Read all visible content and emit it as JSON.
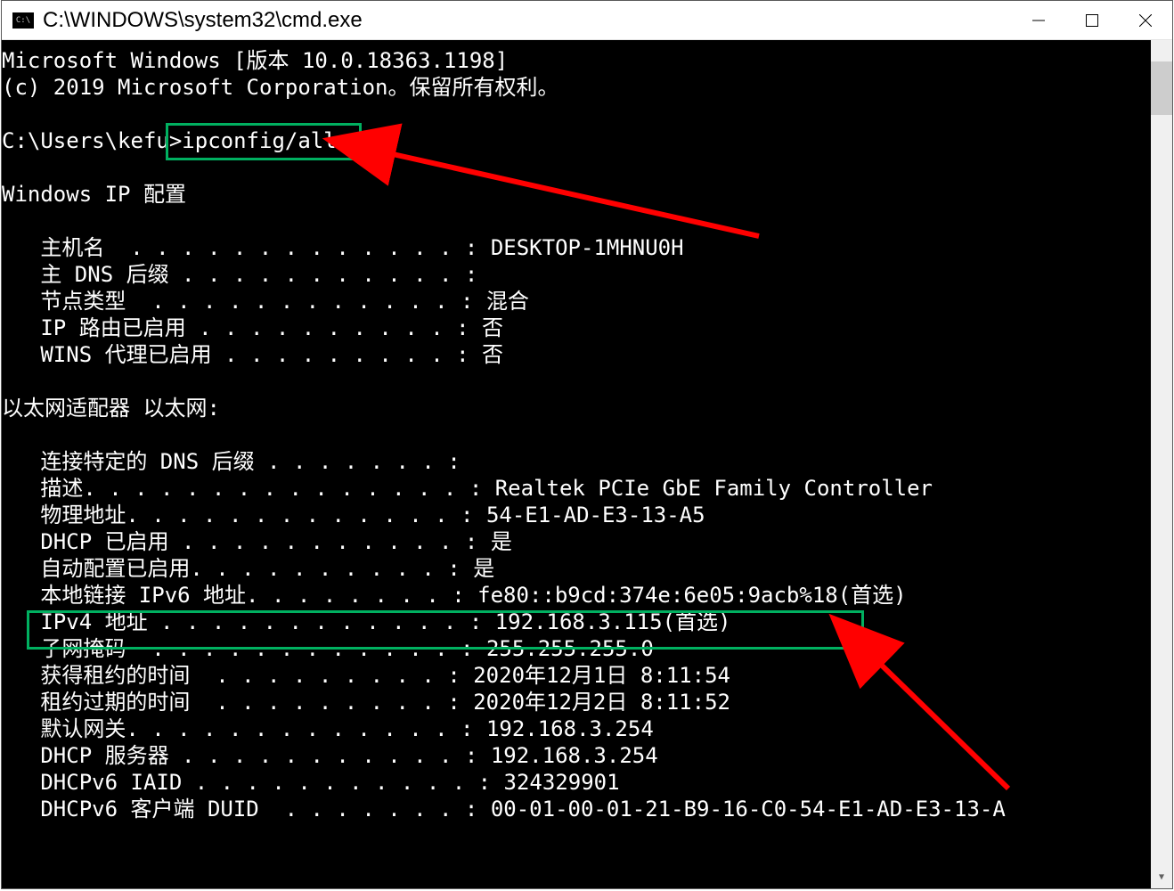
{
  "window": {
    "title": "C:\\WINDOWS\\system32\\cmd.exe"
  },
  "header": {
    "version_line": "Microsoft Windows [版本 10.0.18363.1198]",
    "copyright_line": "(c) 2019 Microsoft Corporation。保留所有权利。"
  },
  "prompt": {
    "path": "C:\\Users\\kefu>",
    "command": "ipconfig/all"
  },
  "sections": {
    "ip_config_header": "Windows IP 配置",
    "host": {
      "hostname_label": "   主机名  . . . . . . . . . . . . . : ",
      "hostname_value": "DESKTOP-1MHNU0H",
      "dns_suffix_label": "   主 DNS 后缀 . . . . . . . . . . . : ",
      "dns_suffix_value": "",
      "node_type_label": "   节点类型  . . . . . . . . . . . . : ",
      "node_type_value": "混合",
      "ip_routing_label": "   IP 路由已启用 . . . . . . . . . . : ",
      "ip_routing_value": "否",
      "wins_proxy_label": "   WINS 代理已启用 . . . . . . . . . : ",
      "wins_proxy_value": "否"
    },
    "adapter_header": "以太网适配器 以太网:",
    "adapter": {
      "conn_dns_label": "   连接特定的 DNS 后缀 . . . . . . . : ",
      "conn_dns_value": "",
      "desc_label": "   描述. . . . . . . . . . . . . . . : ",
      "desc_value": "Realtek PCIe GbE Family Controller",
      "mac_label": "   物理地址. . . . . . . . . . . . . : ",
      "mac_value": "54-E1-AD-E3-13-A5",
      "dhcp_label": "   DHCP 已启用 . . . . . . . . . . . : ",
      "dhcp_value": "是",
      "autoconf_label": "   自动配置已启用. . . . . . . . . . : ",
      "autoconf_value": "是",
      "ipv6ll_label": "   本地链接 IPv6 地址. . . . . . . . : ",
      "ipv6ll_value": "fe80::b9cd:374e:6e05:9acb%18(首选)",
      "ipv4_label": "   IPv4 地址 . . . . . . . . . . . . : ",
      "ipv4_value": "192.168.3.115(首选)",
      "mask_label": "   子网掩码  . . . . . . . . . . . . : ",
      "mask_value": "255.255.255.0",
      "lease_obt_label": "   获得租约的时间  . . . . . . . . . : ",
      "lease_obt_value": "2020年12月1日 8:11:54",
      "lease_exp_label": "   租约过期的时间  . . . . . . . . . : ",
      "lease_exp_value": "2020年12月2日 8:11:52",
      "gateway_label": "   默认网关. . . . . . . . . . . . . : ",
      "gateway_value": "192.168.3.254",
      "dhcp_srv_label": "   DHCP 服务器 . . . . . . . . . . . : ",
      "dhcp_srv_value": "192.168.3.254",
      "iaid_label": "   DHCPv6 IAID . . . . . . . . . . . : ",
      "iaid_value": "324329901",
      "duid_label": "   DHCPv6 客户端 DUID  . . . . . . . : ",
      "duid_value": "00-01-00-01-21-B9-16-C0-54-E1-AD-E3-13-A"
    }
  },
  "annotations": {
    "highlight_command": "ipconfig/all",
    "highlight_ipv4": "IPv4 地址 ... 192.168.3.115(首选)"
  }
}
